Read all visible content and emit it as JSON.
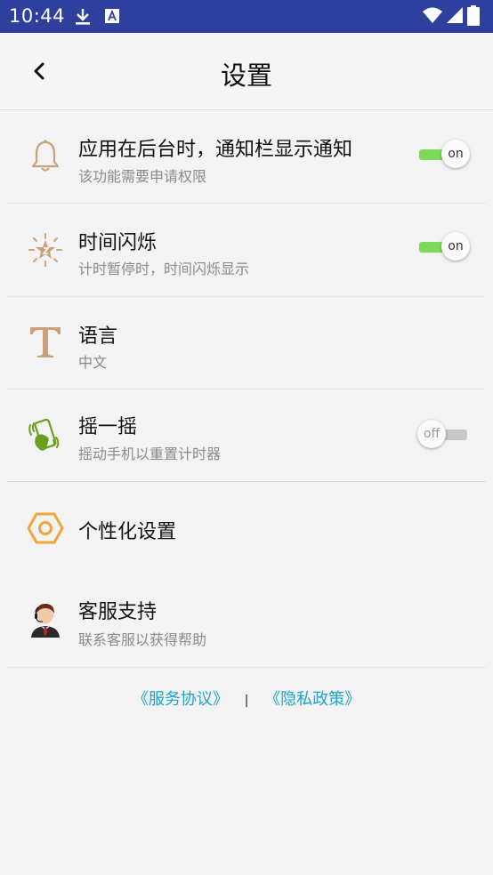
{
  "status_bar": {
    "time": "10:44"
  },
  "header": {
    "title": "设置"
  },
  "settings": [
    {
      "title": "应用在后台时，通知栏显示通知",
      "subtitle": "该功能需要申请权限",
      "toggle": "on"
    },
    {
      "title": "时间闪烁",
      "subtitle": "计时暂停时，时间闪烁显示",
      "toggle": "on"
    },
    {
      "title": "语言",
      "subtitle": "中文"
    },
    {
      "title": "摇一摇",
      "subtitle": "摇动手机以重置计时器",
      "toggle": "off"
    },
    {
      "title": "个性化设置"
    },
    {
      "title": "客服支持",
      "subtitle": "联系客服以获得帮助"
    }
  ],
  "footer": {
    "service_agreement": "《服务协议》",
    "separator": "|",
    "privacy_policy": "《隐私政策》"
  },
  "colors": {
    "status_bar": "#2f3f9e",
    "toggle_on": "#7ed957",
    "link": "#1da4c8",
    "icon_tan": "#c8a27a",
    "icon_orange": "#f0a53a"
  }
}
